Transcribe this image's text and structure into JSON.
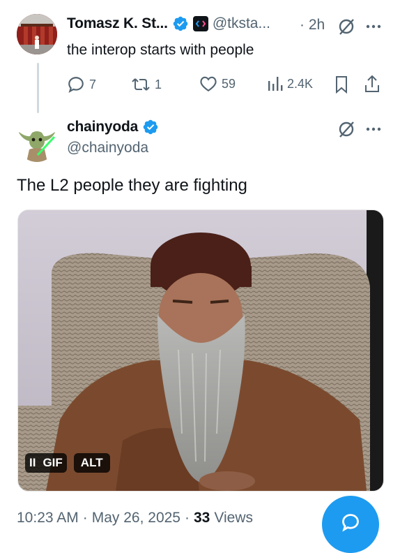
{
  "reply_tweet": {
    "display_name": "Tomasz K. St...",
    "handle": "@tksta...",
    "time": "· 2h",
    "text": "the interop starts with people",
    "stats": {
      "replies": "7",
      "reposts": "1",
      "likes": "59",
      "views": "2.4K"
    }
  },
  "main_tweet": {
    "display_name": "chainyoda",
    "handle": "@chainyoda",
    "text": "The L2 people they are fighting",
    "media": {
      "pause_label": "II",
      "gif_label": "GIF",
      "alt_label": "ALT"
    },
    "meta": {
      "time": "10:23 AM",
      "sep1": "·",
      "date": "May 26, 2025",
      "sep2": "·",
      "views_count": "33",
      "views_label": "Views"
    }
  },
  "icons": {
    "verified": "verified-badge-icon",
    "community": "community-badge-icon",
    "grok": "grok-icon",
    "more": "more-icon",
    "reply": "reply-icon",
    "repost": "repost-icon",
    "like": "like-icon",
    "views": "views-icon",
    "bookmark": "bookmark-icon",
    "share": "share-icon",
    "fab": "reply-fab-icon"
  },
  "colors": {
    "accent": "#1d9bf0",
    "text": "#0f1419",
    "muted": "#536471"
  }
}
